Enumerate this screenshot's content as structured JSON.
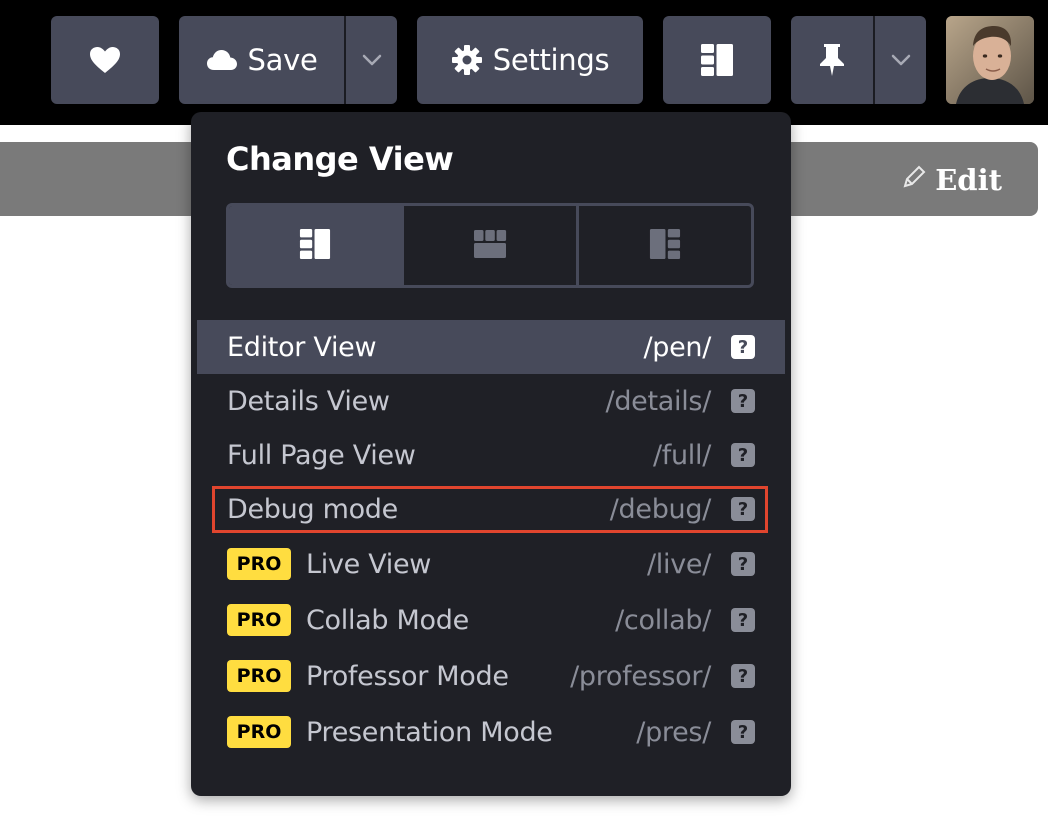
{
  "toolbar": {
    "heart_icon": "heart-icon",
    "save_label": "Save",
    "save_icon": "cloud-icon",
    "save_dropdown_icon": "chevron-down-icon",
    "settings_label": "Settings",
    "settings_icon": "gear-icon",
    "layout_icon": "layout-icon",
    "pin_icon": "pin-icon",
    "pin_dropdown_icon": "chevron-down-icon",
    "avatar": "user-avatar"
  },
  "edit_bar": {
    "edit_label": "Edit",
    "edit_icon": "pencil-icon"
  },
  "change_view": {
    "title": "Change View",
    "layout_options": [
      {
        "icon": "layout-left-icon",
        "active": true
      },
      {
        "icon": "layout-top-icon",
        "active": false
      },
      {
        "icon": "layout-right-icon",
        "active": false
      }
    ],
    "views": [
      {
        "name": "Editor View",
        "path": "/pen/",
        "pro": false,
        "active": true
      },
      {
        "name": "Details View",
        "path": "/details/",
        "pro": false,
        "active": false
      },
      {
        "name": "Full Page View",
        "path": "/full/",
        "pro": false,
        "active": false
      },
      {
        "name": "Debug mode",
        "path": "/debug/",
        "pro": false,
        "active": false,
        "highlighted": true
      },
      {
        "name": "Live View",
        "path": "/live/",
        "pro": true,
        "active": false
      },
      {
        "name": "Collab Mode",
        "path": "/collab/",
        "pro": true,
        "active": false
      },
      {
        "name": "Professor Mode",
        "path": "/professor/",
        "pro": true,
        "active": false
      },
      {
        "name": "Presentation Mode",
        "path": "/pres/",
        "pro": true,
        "active": false
      }
    ],
    "pro_badge": "PRO",
    "help_glyph": "?"
  },
  "colors": {
    "toolbar_bg": "#000000",
    "button_bg": "#474a5a",
    "popup_bg": "#1f2026",
    "pro_badge": "#ffdd40",
    "highlight": "#e0452e",
    "edit_bar": "#7a7a7a"
  }
}
